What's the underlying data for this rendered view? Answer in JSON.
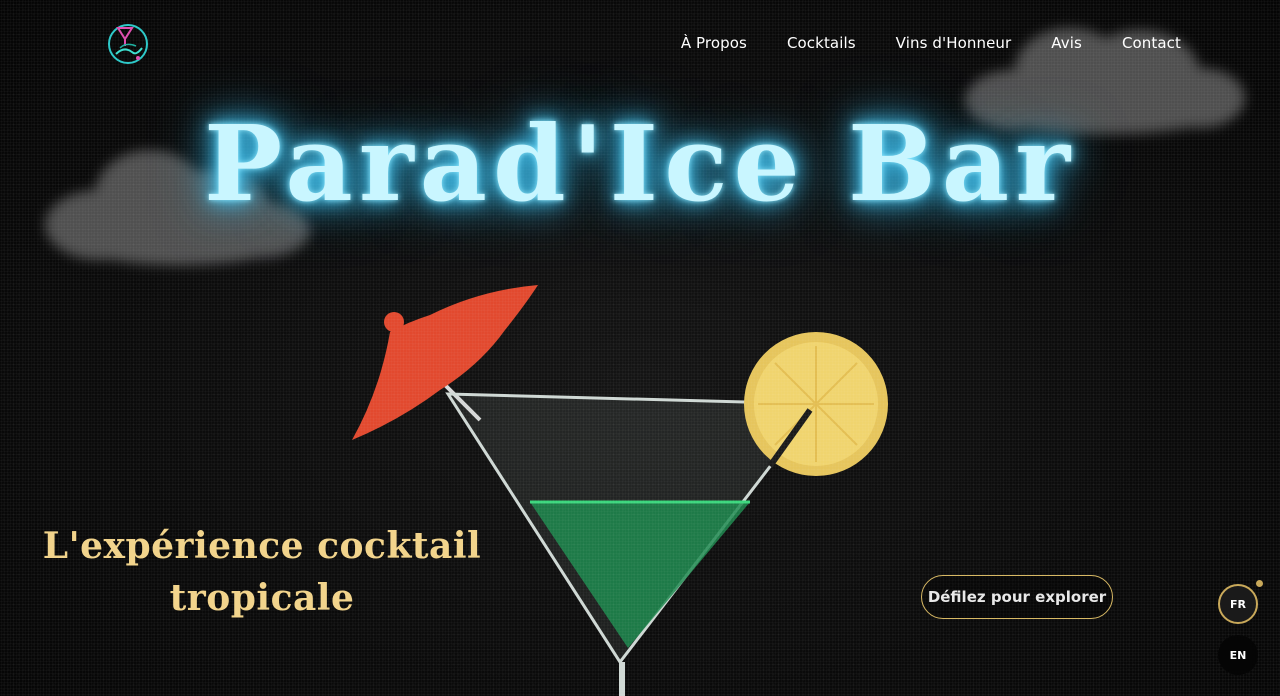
{
  "site": {
    "name": "Parad'Ice Bar"
  },
  "nav": {
    "items": [
      {
        "label": "À Propos"
      },
      {
        "label": "Cocktails"
      },
      {
        "label": "Vins d'Honneur"
      },
      {
        "label": "Avis"
      },
      {
        "label": "Contact"
      }
    ]
  },
  "hero": {
    "title": "Parad'Ice Bar",
    "tagline_line1": "L'expérience cocktail",
    "tagline_line2": "tropicale",
    "scroll_button": "Défilez pour explorer"
  },
  "language": {
    "options": [
      "FR",
      "EN"
    ],
    "active": "FR"
  },
  "colors": {
    "background": "#0b0b0b",
    "title_glow": "#4fd2ff",
    "title_text": "#c9f6ff",
    "tagline": "#f2d48c",
    "accent_gold": "#c9a95a"
  },
  "icons": {
    "logo": "cocktail-glass-logo",
    "cocktail": "martini-glass-illustration"
  }
}
